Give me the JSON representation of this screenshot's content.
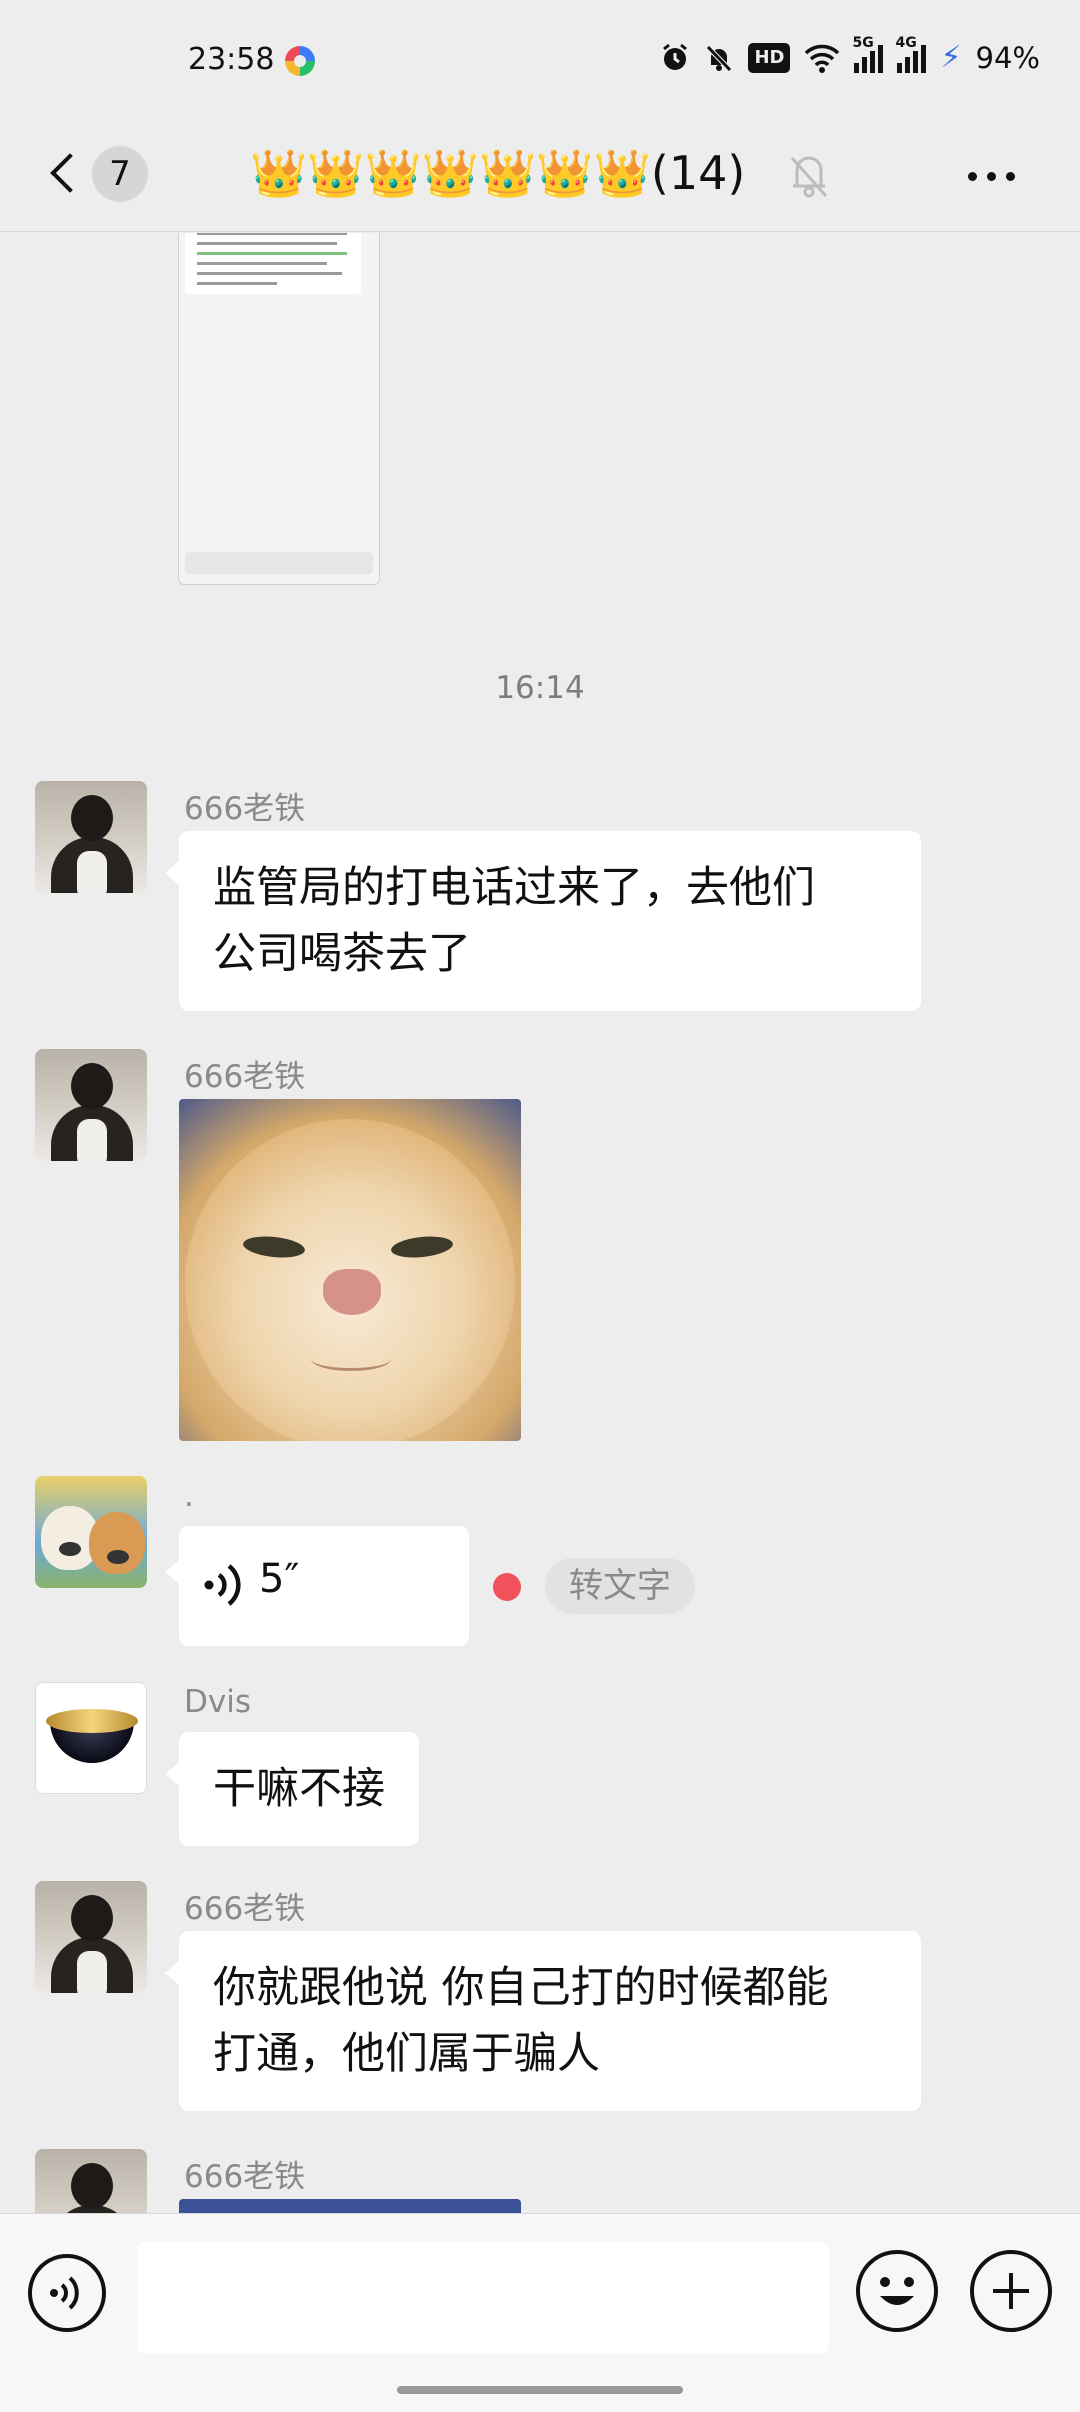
{
  "status_bar": {
    "time": "23:58",
    "hd_badge": "HD",
    "network_5g": "5G",
    "network_4g": "4G",
    "battery": "94%",
    "icons": [
      "alarm-icon",
      "mute-bell-icon",
      "hd-voice-icon",
      "wifi-icon",
      "signal-5g-icon",
      "signal-4g-icon",
      "charging-icon"
    ]
  },
  "header": {
    "back_icon": "chevron-left-icon",
    "unread_count": "7",
    "title": "👑👑👑👑👑👑👑(14)",
    "mute_icon": "muted-bell-icon",
    "more_icon": "more-icon"
  },
  "chat": {
    "timestamp": "16:14",
    "messages": [
      {
        "sender": "666老铁",
        "text": "监管局的打电话过来了，去他们\n公司喝茶去了"
      },
      {
        "sender": "666老铁",
        "sticker": "cat-face-sticker"
      },
      {
        "sender": ".",
        "voice_length": "5″",
        "convert_label": "转文字"
      },
      {
        "sender": "Dvis",
        "text": "干嘛不接"
      },
      {
        "sender": "666老铁",
        "text": "你就跟他说 你自己打的时候都能\n打通，他们属于骗人"
      },
      {
        "sender": "666老铁",
        "sticker": "cat-face-sticker"
      }
    ]
  },
  "input_bar": {
    "voice_icon": "voice-input-icon",
    "input_value": "",
    "emoji_icon": "emoji-icon",
    "plus_icon": "plus-icon"
  },
  "colors": {
    "background": "#ededed",
    "bubble": "#ffffff",
    "unread_dot": "#f0525b",
    "sender_name": "#8a8a8a"
  }
}
